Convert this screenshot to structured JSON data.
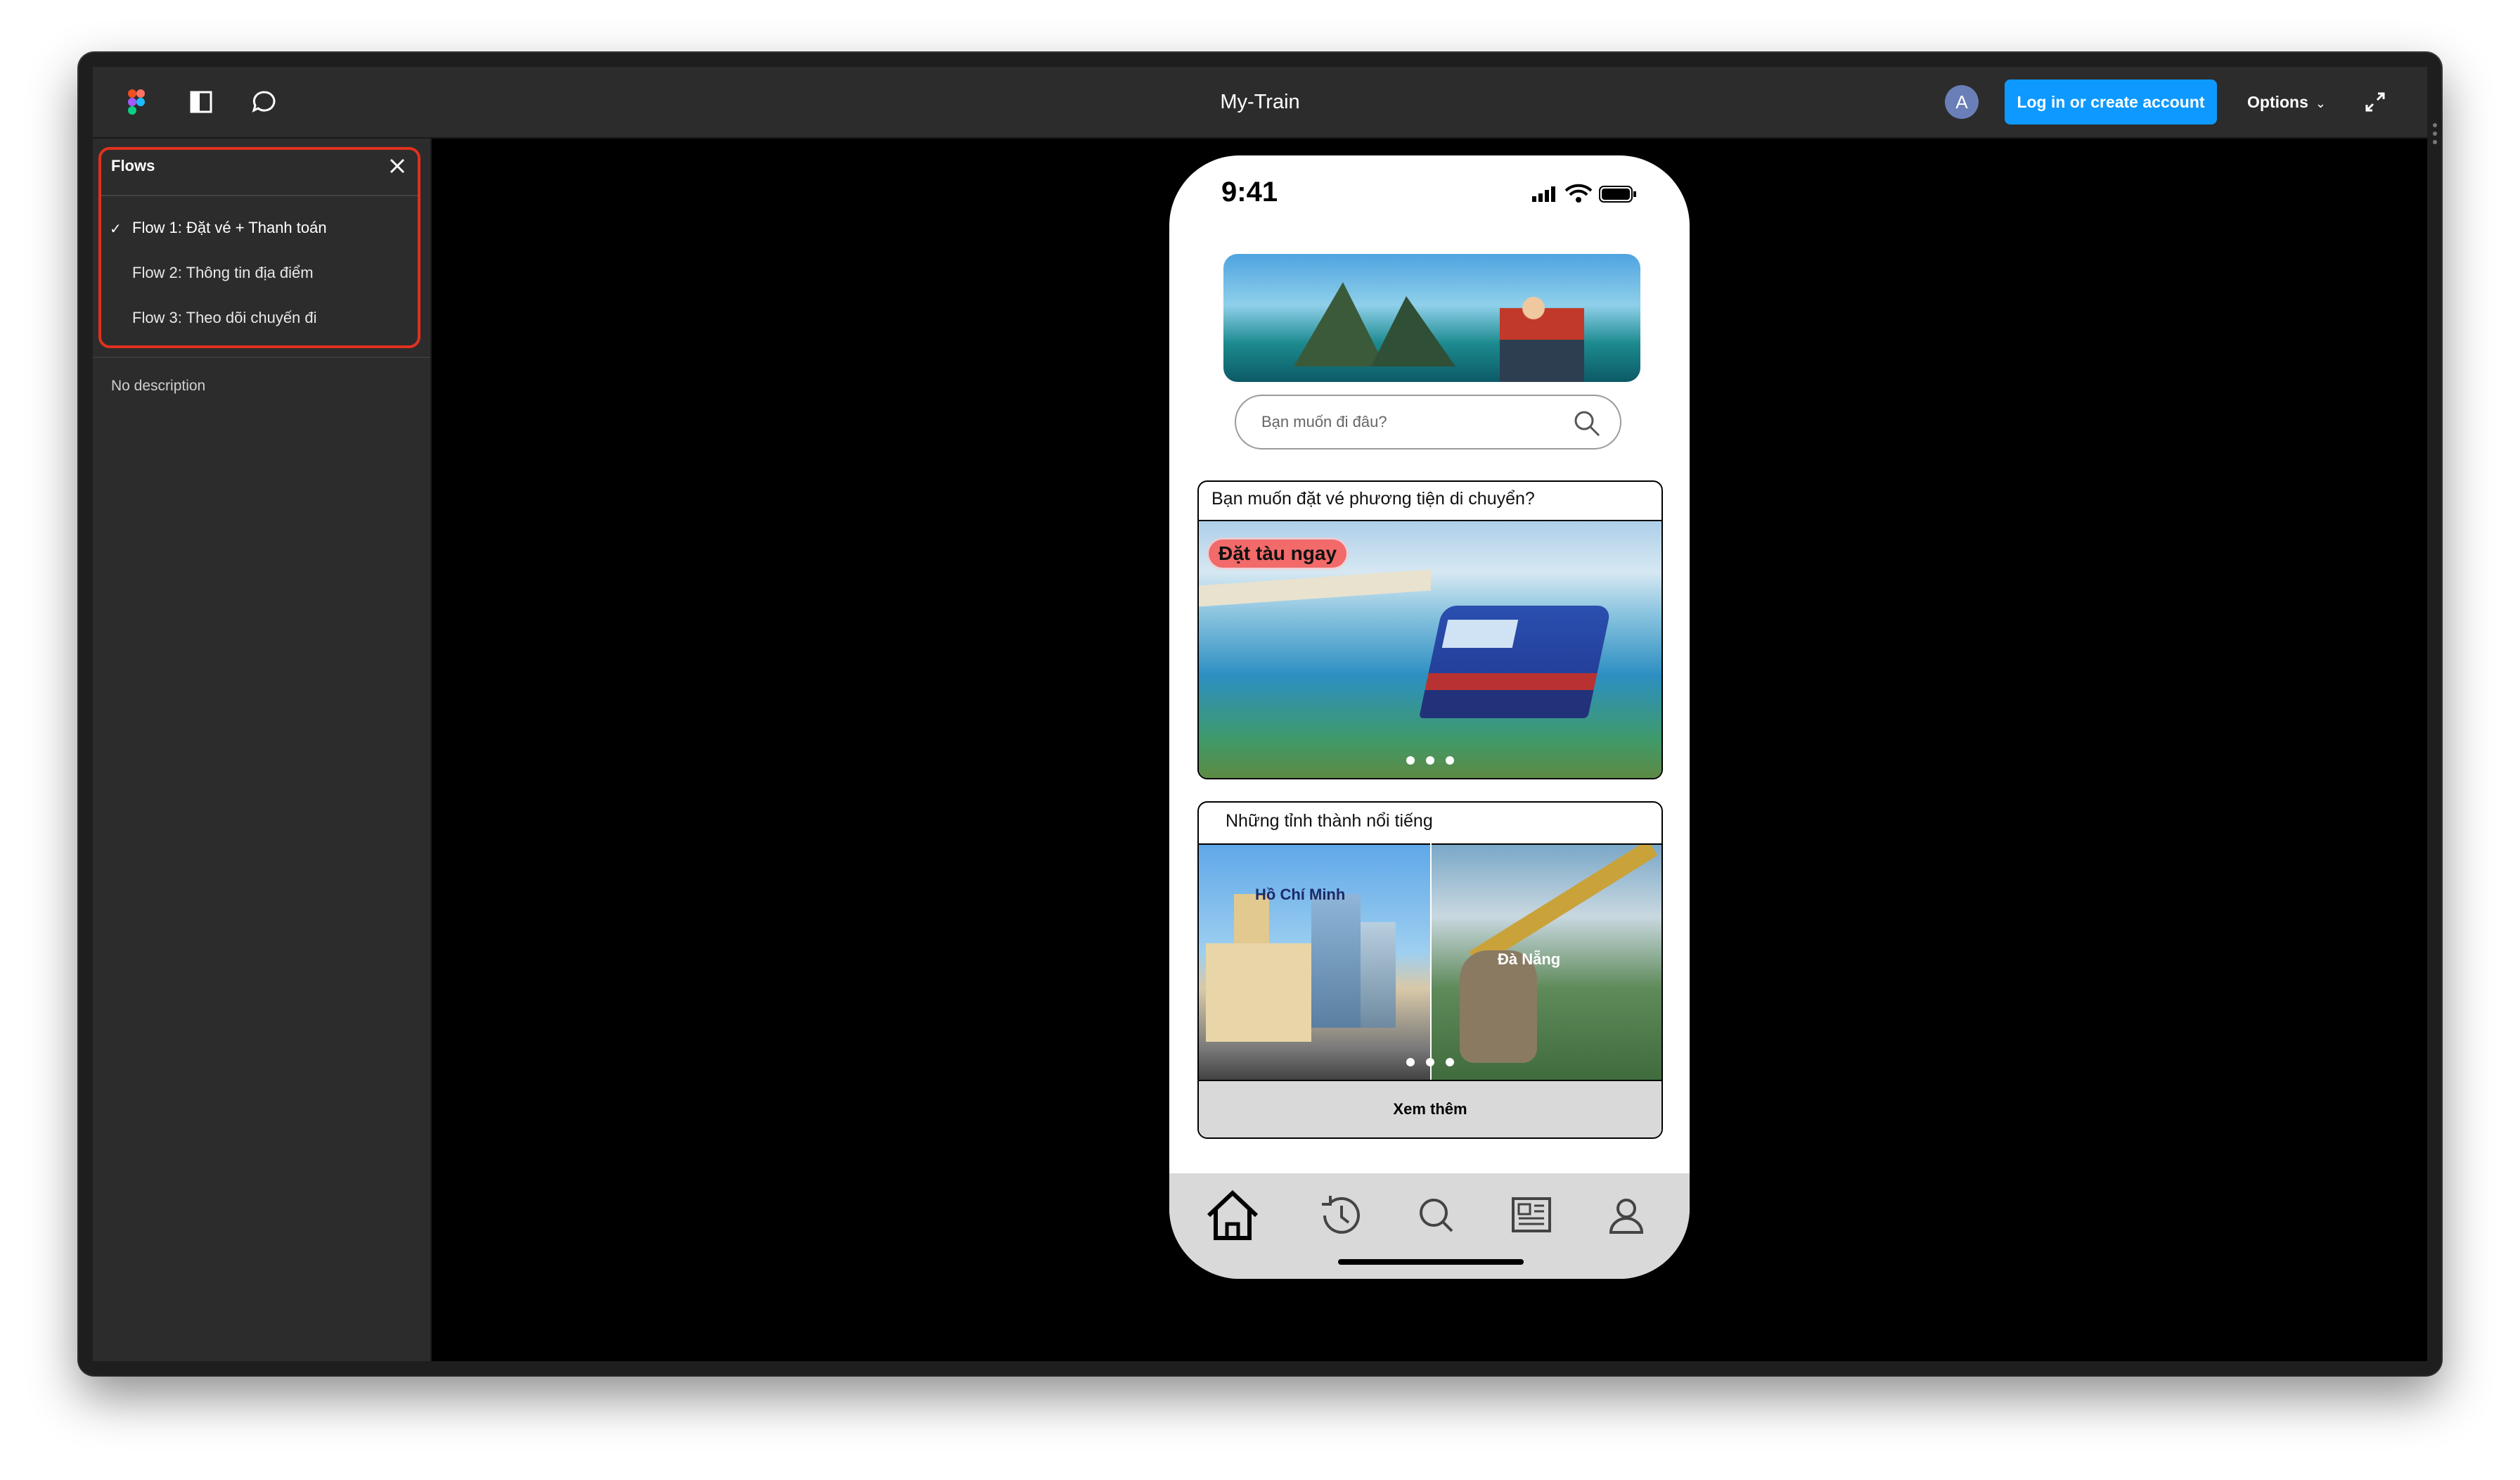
{
  "app": {
    "doc_title": "My-Train",
    "avatar_letter": "A",
    "login_label": "Log in or create account",
    "options_label": "Options",
    "icons": [
      "figma-logo-icon",
      "panel-toggle-icon",
      "comment-icon",
      "expand-icon"
    ]
  },
  "sidebar": {
    "header": "Flows",
    "flows": [
      {
        "label": "Flow 1: Đặt vé + Thanh toán",
        "selected": true
      },
      {
        "label": "Flow 2: Thông tin địa điểm",
        "selected": false
      },
      {
        "label": "Flow 3: Theo dõi chuyến đi",
        "selected": false
      }
    ],
    "description": "No description"
  },
  "phone": {
    "time": "9:41",
    "search_placeholder": "Bạn muốn đi đâu?",
    "card1": {
      "title": "Bạn muốn đặt vé phương tiện di chuyển?",
      "cta": "Đặt tàu ngay"
    },
    "card2": {
      "title": "Những tỉnh thành nổi tiếng",
      "cities": [
        "Hồ Chí Minh",
        "Đà Nẵng"
      ],
      "see_more": "Xem thêm"
    },
    "tabs": [
      "home-icon",
      "history-icon",
      "search-icon",
      "news-icon",
      "profile-icon"
    ]
  },
  "colors": {
    "accent": "#0d99ff",
    "highlight_border": "#e0311f",
    "cta": "#f26a6a"
  }
}
